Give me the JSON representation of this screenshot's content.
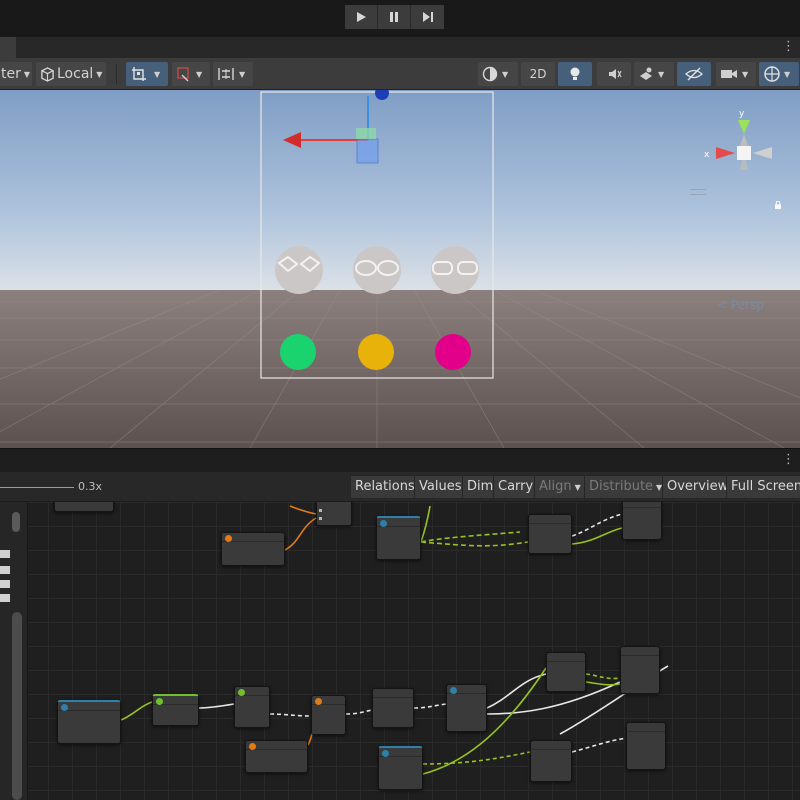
{
  "playbar": {
    "play_icon": "play-icon",
    "pause_icon": "pause-icon",
    "step_icon": "step-icon"
  },
  "toolbar": {
    "pivot_label": "ter",
    "space_label": "Local",
    "mode_2d_label": "2D",
    "icons": [
      "grid-snap-icon",
      "increment-snap-icon",
      "view-align-icon",
      "shading-icon",
      "light-icon",
      "audio-icon",
      "effects-icon",
      "visibility-icon",
      "camera-icon",
      "gizmos-icon"
    ]
  },
  "scene": {
    "persp_label": "Persp",
    "gizmo_labels": {
      "x": "x",
      "y": "y"
    },
    "colors": {
      "sky_top": "#7f9dc5",
      "ground": "#6b5f5d",
      "green": "#1bd36e",
      "yellow": "#e8b20b",
      "magenta": "#e2008a",
      "face": "#c8c4c3"
    }
  },
  "graph_toolbar": {
    "zoom_value": "0.3x",
    "buttons": {
      "relations": "Relations",
      "values": "Values",
      "dim": "Dim",
      "carry": "Carry",
      "align": "Align",
      "distribute": "Distribute",
      "overview": "Overview",
      "full_screen": "Full Screen"
    }
  },
  "graph": {
    "colors": {
      "wire_green": "#98c21f",
      "wire_white": "#e6e6e6",
      "wire_orange": "#e07b1a",
      "accent_blue": "#2f7fa8",
      "accent_green": "#6fc02c"
    }
  }
}
